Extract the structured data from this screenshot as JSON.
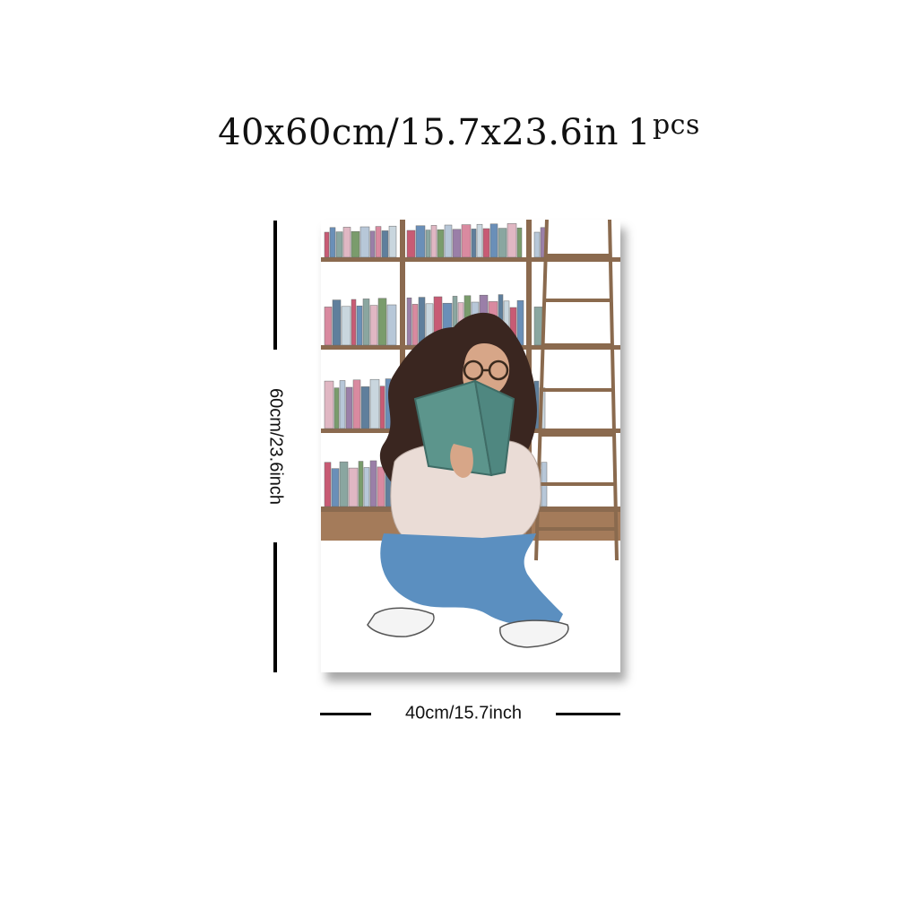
{
  "title": {
    "size_text": "40x60cm/15.7x23.6in",
    "qty_number": "1",
    "qty_unit": "pcs"
  },
  "dimensions": {
    "height_label": "60cm/23.6inch",
    "width_label": "40cm/15.7inch"
  },
  "artwork": {
    "subject": "girl-reading-book-illustration"
  },
  "colors": {
    "shelf_wood": "#8b6a4f",
    "denim": "#5b8fc0",
    "book_cover": "#5c958c",
    "hair": "#3a2620",
    "sweater": "#e9dcd6"
  }
}
